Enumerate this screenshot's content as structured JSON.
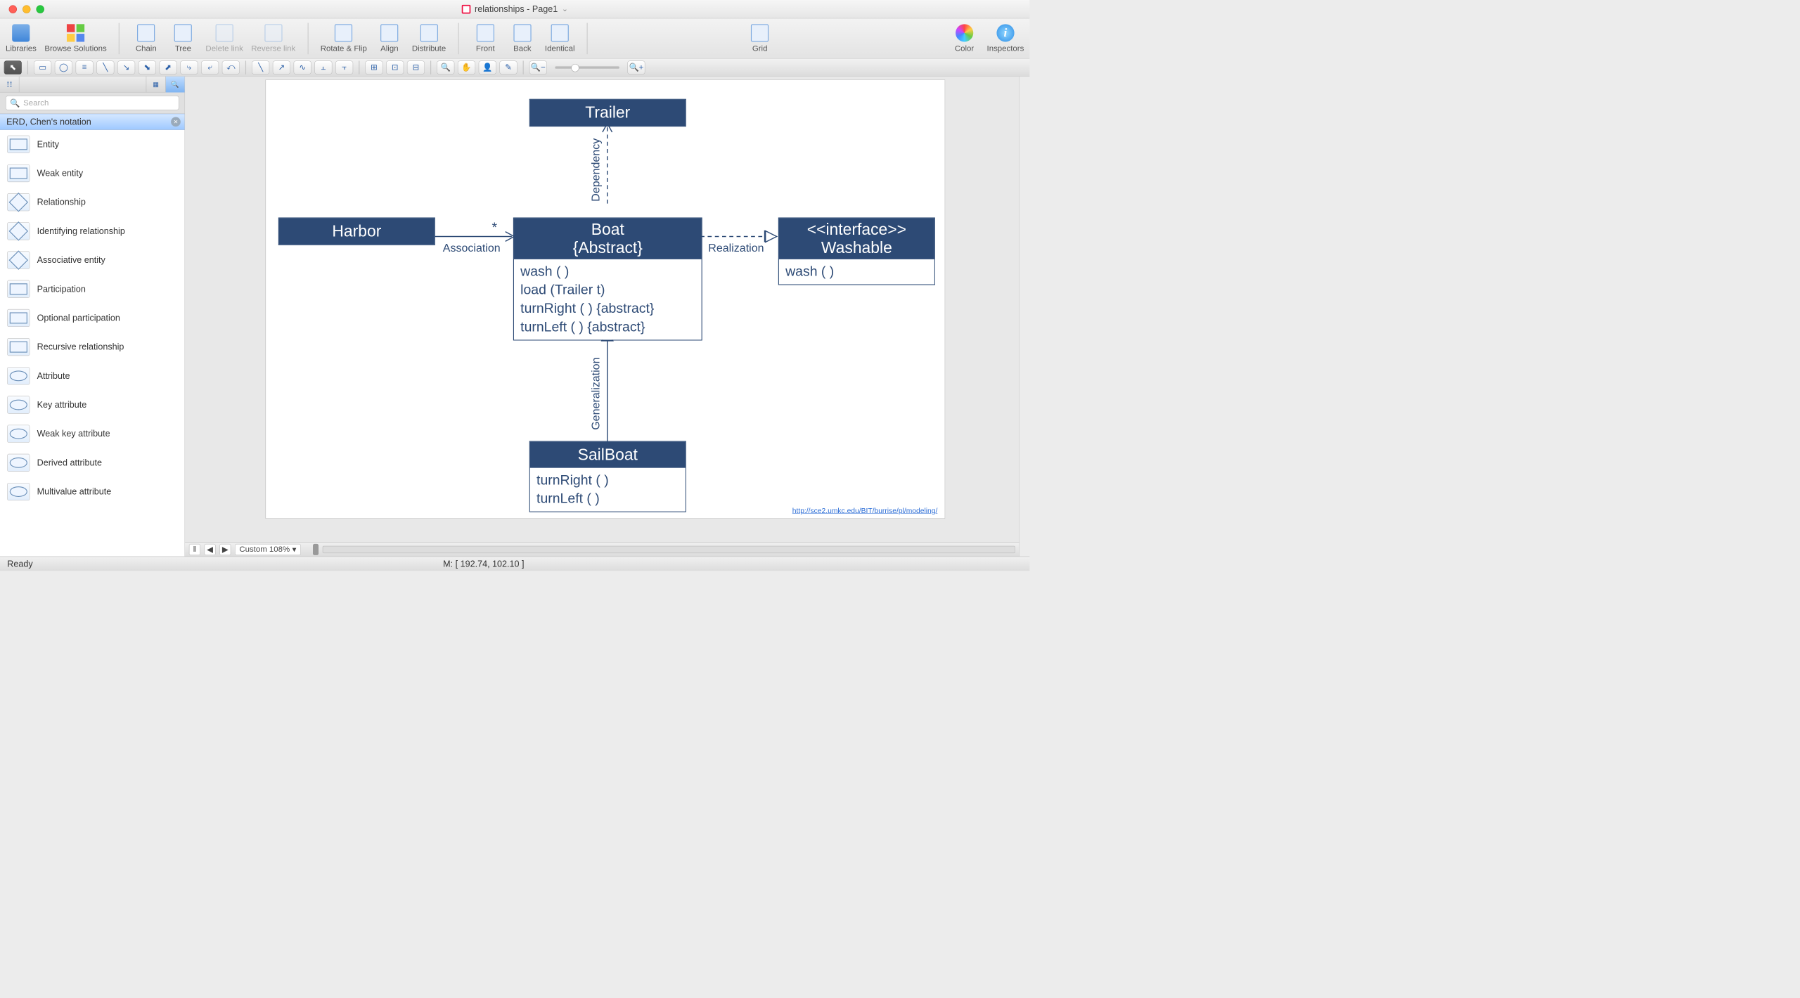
{
  "window": {
    "title": "relationships - Page1"
  },
  "toolbar": {
    "libraries": "Libraries",
    "browse": "Browse Solutions",
    "chain": "Chain",
    "tree": "Tree",
    "delete_link": "Delete link",
    "reverse_link": "Reverse link",
    "rotate_flip": "Rotate & Flip",
    "align": "Align",
    "distribute": "Distribute",
    "front": "Front",
    "back": "Back",
    "identical": "Identical",
    "grid": "Grid",
    "color": "Color",
    "inspectors": "Inspectors"
  },
  "sidebar": {
    "search_placeholder": "Search",
    "category": "ERD, Chen's notation",
    "items": [
      {
        "label": "Entity",
        "shape": "rect"
      },
      {
        "label": "Weak entity",
        "shape": "rect"
      },
      {
        "label": "Relationship",
        "shape": "diamond"
      },
      {
        "label": "Identifying relationship",
        "shape": "diamond"
      },
      {
        "label": "Associative entity",
        "shape": "diamond"
      },
      {
        "label": "Participation",
        "shape": "rect"
      },
      {
        "label": "Optional participation",
        "shape": "rect"
      },
      {
        "label": "Recursive relationship",
        "shape": "rect"
      },
      {
        "label": "Attribute",
        "shape": "ellipse"
      },
      {
        "label": "Key attribute",
        "shape": "ellipse"
      },
      {
        "label": "Weak key attribute",
        "shape": "ellipse"
      },
      {
        "label": "Derived attribute",
        "shape": "ellipse"
      },
      {
        "label": "Multivalue attribute",
        "shape": "ellipse"
      }
    ]
  },
  "diagram": {
    "trailer": {
      "title": "Trailer"
    },
    "harbor": {
      "title": "Harbor"
    },
    "boat": {
      "title_line1": "Boat",
      "title_line2": "{Abstract}",
      "ops": [
        "wash ( )",
        "load (Trailer t)",
        "turnRight ( ) {abstract}",
        "turnLeft ( ) {abstract}"
      ]
    },
    "washable": {
      "title_line1": "<<interface>>",
      "title_line2": "Washable",
      "ops": [
        "wash ( )"
      ]
    },
    "sailboat": {
      "title": "SailBoat",
      "ops": [
        "turnRight ( )",
        "turnLeft ( )"
      ]
    },
    "labels": {
      "dependency": "Dependency",
      "association": "Association",
      "multiplicity": "*",
      "realization": "Realization",
      "generalization": "Generalization"
    },
    "link": "http://sce2.umkc.edu/BIT/burrise/pl/modeling/"
  },
  "bottom": {
    "zoom": "Custom 108%"
  },
  "status": {
    "ready": "Ready",
    "mouse": "M: [ 192.74, 102.10 ]"
  }
}
